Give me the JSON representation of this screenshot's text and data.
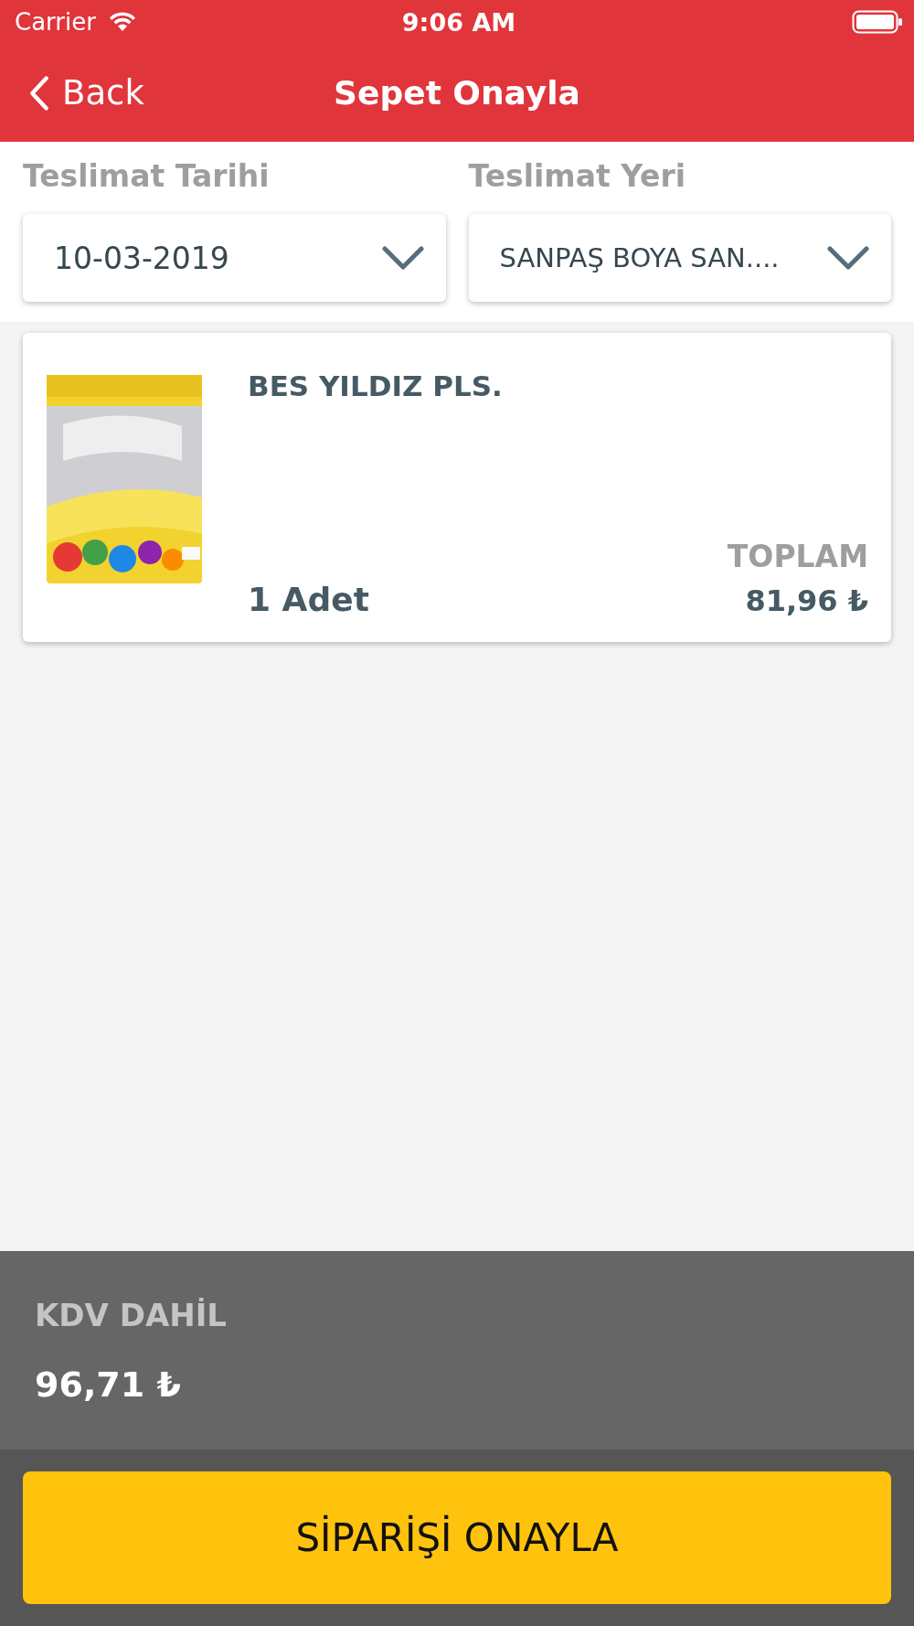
{
  "status_bar": {
    "carrier": "Carrier",
    "time": "9:06 AM"
  },
  "nav_bar": {
    "back": "Back",
    "title": "Sepet Onayla"
  },
  "fields": [
    {
      "label": "Teslimat Tarihi",
      "value": "10-03-2019"
    },
    {
      "label": "Teslimat Yeri",
      "value": "SANPAŞ BOYA SAN...."
    }
  ],
  "items": [
    {
      "name": "BES YILDIZ PLS.",
      "quantity": "1 Adet",
      "total_label": "TOPLAM",
      "total": "81,96 ₺"
    }
  ],
  "summary": {
    "label": "KDV DAHİL",
    "amount": "96,71 ₺"
  },
  "confirm_button": "SİPARİŞİ ONAYLA"
}
